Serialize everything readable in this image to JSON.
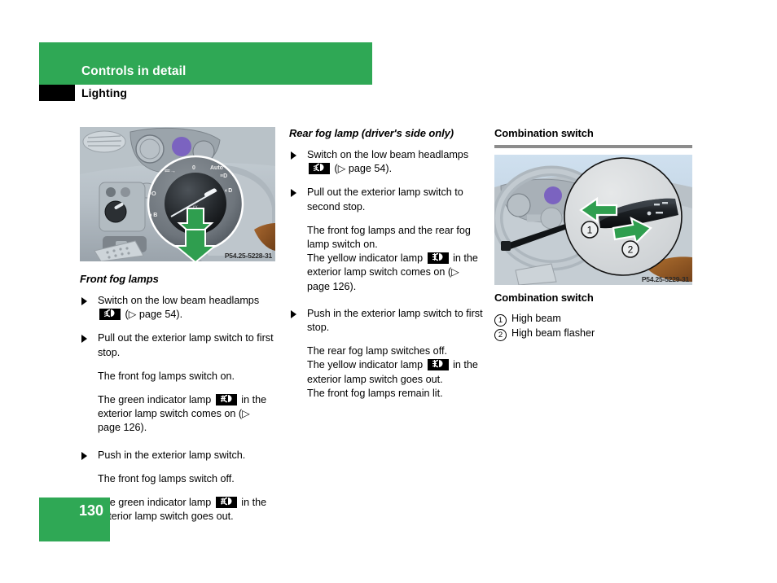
{
  "header": {
    "chapter": "Controls in detail",
    "section": "Lighting"
  },
  "footer": {
    "page_number": "130"
  },
  "colors": {
    "accent_green": "#2fa855",
    "rule_gray": "#8c8c8c",
    "pictogram_bg": "#000000"
  },
  "left_column": {
    "figure": {
      "name": "dashboard-light-switch-photo",
      "code": "P54.25-5228-31",
      "alt": "Driver side dashboard with exterior lamp switch magnified, green pull-out arrows"
    },
    "heading": "Front fog lamps",
    "blocks": [
      {
        "type": "step",
        "text_before": "Switch on the low beam headlamps ",
        "pictogram": "low-beam-headlamp-icon",
        "text_after": " (▷ page 54)."
      },
      {
        "type": "step",
        "text_before": "Pull out the exterior lamp switch to first stop.",
        "pictogram": null,
        "text_after": ""
      },
      {
        "type": "para",
        "text_before": "The front fog lamps switch on.",
        "pictogram": null,
        "text_after": ""
      },
      {
        "type": "para",
        "text_before": "The green indicator lamp ",
        "pictogram": "front-fog-lamp-icon",
        "text_after": " in the exterior lamp switch comes on (▷ page 126)."
      },
      {
        "type": "step",
        "text_before": "Push in the exterior lamp switch.",
        "pictogram": null,
        "text_after": ""
      },
      {
        "type": "para",
        "text_before": "The front fog lamps switch off.",
        "pictogram": null,
        "text_after": ""
      },
      {
        "type": "para",
        "text_before": "The green indicator lamp ",
        "pictogram": "front-fog-lamp-icon",
        "text_after": " in the exterior lamp switch goes out."
      }
    ]
  },
  "middle_column": {
    "heading": "Rear fog lamp (driver's side only)",
    "blocks": [
      {
        "type": "step",
        "text_before": "Switch on the low beam headlamps ",
        "pictogram": "low-beam-headlamp-icon",
        "text_after": " (▷ page 54)."
      },
      {
        "type": "step",
        "text_before": "Pull out the exterior lamp switch to second stop.",
        "pictogram": null,
        "text_after": ""
      },
      {
        "type": "para",
        "text_before": "The front fog lamps and the rear fog lamp switch on.",
        "pictogram": null,
        "text_after": ""
      },
      {
        "type": "para-tight",
        "text_before": "The yellow indicator lamp ",
        "pictogram": "rear-fog-lamp-icon",
        "text_after": " in the exterior lamp switch comes on (▷ page 126)."
      },
      {
        "type": "step",
        "text_before": "Push in the exterior lamp switch to first stop.",
        "pictogram": null,
        "text_after": ""
      },
      {
        "type": "para-tight",
        "text_before": "The rear fog lamp switches off.",
        "pictogram": null,
        "text_after": ""
      },
      {
        "type": "para-tight",
        "text_before": "The yellow indicator lamp ",
        "pictogram": "rear-fog-lamp-icon",
        "text_after": " in the exterior lamp switch goes out."
      },
      {
        "type": "para",
        "text_before": "The front fog lamps remain lit.",
        "pictogram": null,
        "text_after": ""
      }
    ]
  },
  "right_column": {
    "heading": "Combination switch",
    "figure": {
      "name": "combination-switch-photo",
      "code": "P54.25-5229-31",
      "alt": "Steering wheel with combination switch stalk magnified, green arrows 1 and 2",
      "callouts": [
        {
          "num": "1"
        },
        {
          "num": "2"
        }
      ]
    },
    "caption": "Combination switch",
    "legend": [
      {
        "num": "1",
        "label": "High beam"
      },
      {
        "num": "2",
        "label": "High beam flasher"
      }
    ]
  }
}
